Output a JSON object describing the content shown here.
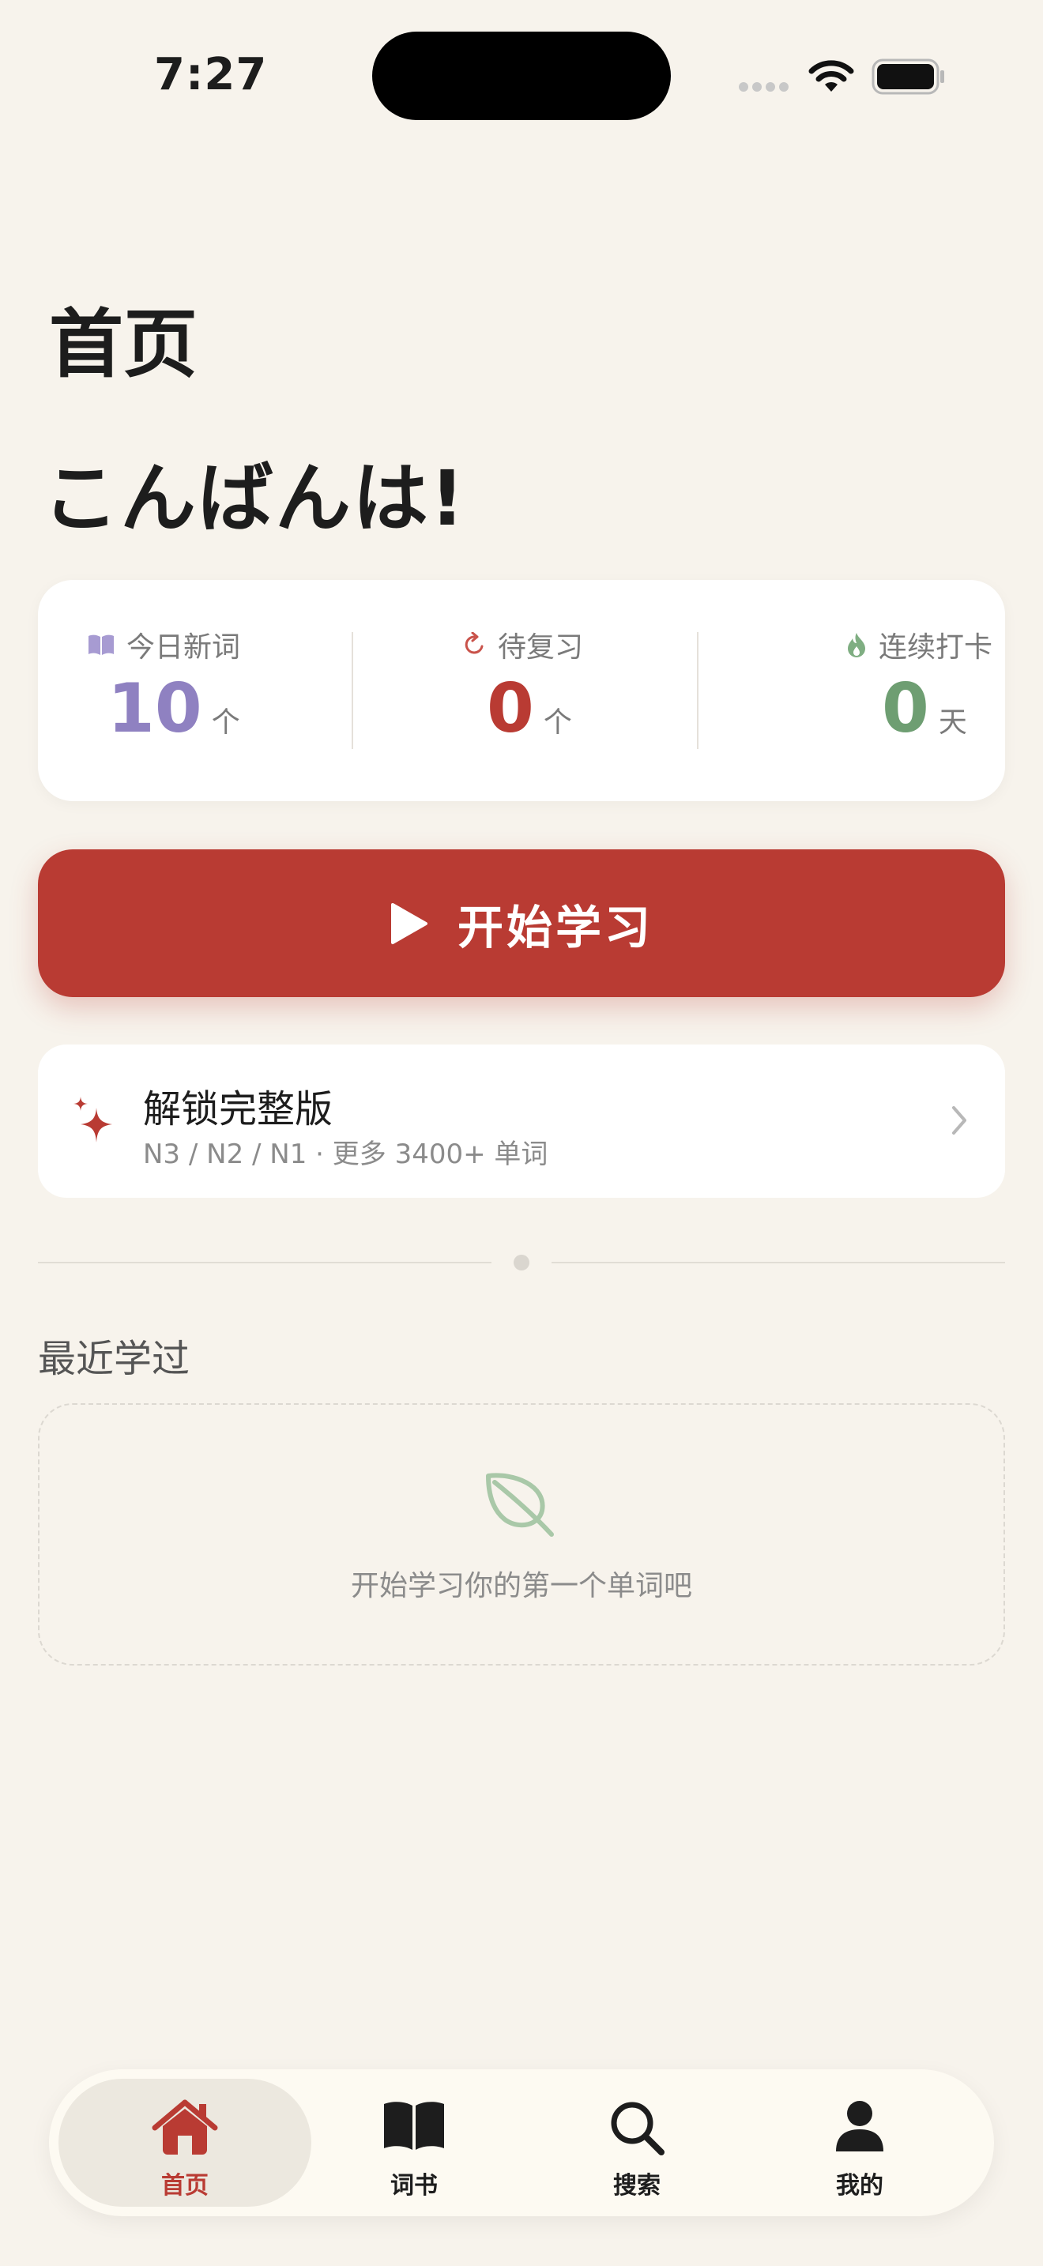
{
  "status_bar": {
    "time": "7:27"
  },
  "header": {
    "title": "首页",
    "greeting": "こんばんは!"
  },
  "stats": {
    "new_words": {
      "label": "今日新词",
      "value": "10",
      "unit": "个",
      "icon": "book-icon",
      "color": "#8f81c1"
    },
    "review": {
      "label": "待复习",
      "value": "0",
      "unit": "个",
      "icon": "refresh-icon",
      "color": "#b93b33"
    },
    "streak": {
      "label": "连续打卡",
      "value": "0",
      "unit": "天",
      "icon": "flame-icon",
      "color": "#6e9e72"
    }
  },
  "start_button": {
    "label": "开始学习",
    "icon": "play-icon",
    "color": "#b93b33"
  },
  "unlock": {
    "title": "解锁完整版",
    "subtitle": "N3 / N2 / N1 · 更多 3400+ 单词",
    "icon": "sparkle-icon"
  },
  "recent": {
    "title": "最近学过",
    "empty_text": "开始学习你的第一个单词吧",
    "empty_icon": "leaf-icon"
  },
  "tabbar": {
    "tabs": [
      {
        "label": "首页",
        "icon": "home-icon",
        "active": true
      },
      {
        "label": "词书",
        "icon": "open-book-icon",
        "active": false
      },
      {
        "label": "搜索",
        "icon": "search-icon",
        "active": false
      },
      {
        "label": "我的",
        "icon": "person-icon",
        "active": false
      }
    ]
  },
  "theme": {
    "accent": "#b93b33",
    "background": "#f7f3ec"
  }
}
